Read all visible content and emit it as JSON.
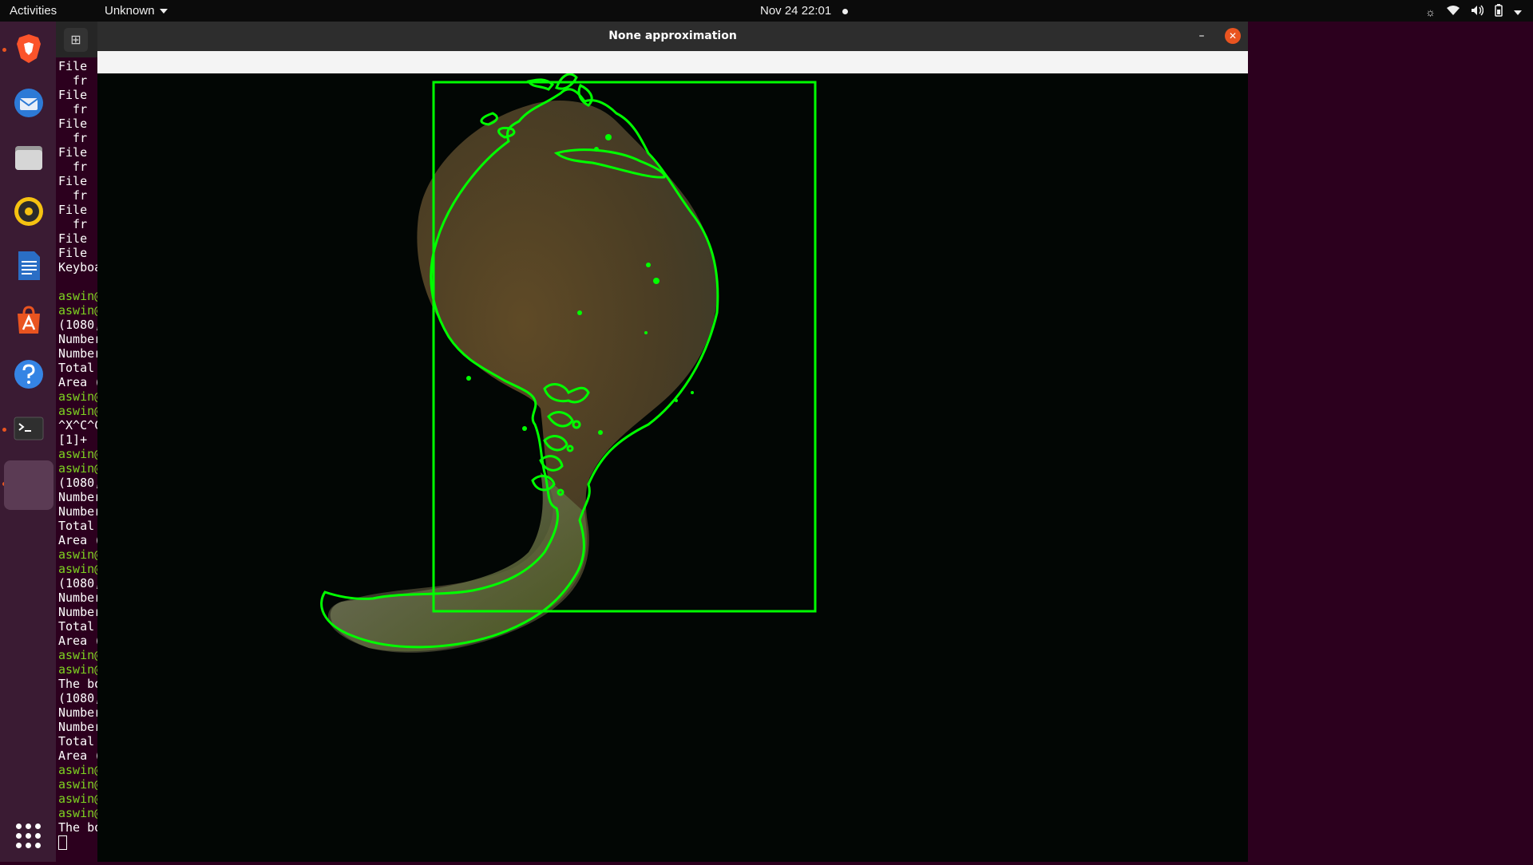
{
  "topbar": {
    "activities": "Activities",
    "app_menu": "Unknown",
    "clock": "Nov 24  22:01",
    "tray_icons": [
      "brightness-icon",
      "wifi-icon",
      "volume-icon",
      "battery-icon",
      "menu-caret-icon"
    ]
  },
  "dock": {
    "items": [
      {
        "name": "brave-browser",
        "color": "#fb542b"
      },
      {
        "name": "thunderbird",
        "color": "#2d7ad6"
      },
      {
        "name": "files",
        "color": "#c9c9c9"
      },
      {
        "name": "rhythmbox",
        "color": "#f5c211"
      },
      {
        "name": "libreoffice-writer",
        "color": "#2a6ec5"
      },
      {
        "name": "ubuntu-software",
        "color": "#e95420"
      },
      {
        "name": "help",
        "color": "#3584e4"
      },
      {
        "name": "terminal",
        "color": "#2f2f2f"
      },
      {
        "name": "python-window",
        "color": "#5b3b54"
      }
    ]
  },
  "terminal": {
    "lines": [
      {
        "t": "File",
        "g": false
      },
      {
        "t": "  fr",
        "g": false
      },
      {
        "t": "File",
        "g": false
      },
      {
        "t": "  fr",
        "g": false
      },
      {
        "t": "File",
        "g": false
      },
      {
        "t": "  fr",
        "g": false
      },
      {
        "t": "File",
        "g": false
      },
      {
        "t": "  fr",
        "g": false
      },
      {
        "t": "File",
        "g": false
      },
      {
        "t": "  fr",
        "g": false
      },
      {
        "t": "File",
        "g": false
      },
      {
        "t": "  fr",
        "g": false
      },
      {
        "t": "File",
        "g": false
      },
      {
        "t": "File",
        "g": false
      },
      {
        "t": "Keyboa",
        "g": false
      },
      {
        "t": "",
        "g": false
      },
      {
        "t": "aswin@",
        "g": true
      },
      {
        "t": "aswin@",
        "g": true
      },
      {
        "t": "(1080,",
        "g": false
      },
      {
        "t": "Number",
        "g": false
      },
      {
        "t": "Number",
        "g": false
      },
      {
        "t": "Total ",
        "g": false
      },
      {
        "t": "Area (",
        "g": false
      },
      {
        "t": "aswin@",
        "g": true
      },
      {
        "t": "aswin@",
        "g": true
      },
      {
        "t": "^X^C^C",
        "g": false
      },
      {
        "t": "[1]+  ",
        "g": false
      },
      {
        "t": "aswin@",
        "g": true
      },
      {
        "t": "aswin@",
        "g": true
      },
      {
        "t": "(1080,",
        "g": false
      },
      {
        "t": "Number",
        "g": false
      },
      {
        "t": "Number",
        "g": false
      },
      {
        "t": "Total ",
        "g": false
      },
      {
        "t": "Area (",
        "g": false
      },
      {
        "t": "aswin@",
        "g": true
      },
      {
        "t": "aswin@",
        "g": true
      },
      {
        "t": "(1080,",
        "g": false
      },
      {
        "t": "Number",
        "g": false
      },
      {
        "t": "Number",
        "g": false
      },
      {
        "t": "Total ",
        "g": false
      },
      {
        "t": "Area (",
        "g": false
      },
      {
        "t": "aswin@",
        "g": true
      },
      {
        "t": "aswin@",
        "g": true
      },
      {
        "t": "The bo",
        "g": false
      },
      {
        "t": "(1080,",
        "g": false
      },
      {
        "t": "Number",
        "g": false
      },
      {
        "t": "Number",
        "g": false
      },
      {
        "t": "Total ",
        "g": false
      },
      {
        "t": "Area (",
        "g": false
      },
      {
        "t": "aswin@",
        "g": true
      },
      {
        "t": "aswin@",
        "g": true
      },
      {
        "t": "aswin@",
        "g": true
      },
      {
        "t": "aswin@",
        "g": true
      },
      {
        "t": "The bo",
        "g": false
      }
    ]
  },
  "cv_window": {
    "title": "None approximation",
    "min_label": "–",
    "close_label": "✕",
    "contour_color": "#00ff00"
  }
}
